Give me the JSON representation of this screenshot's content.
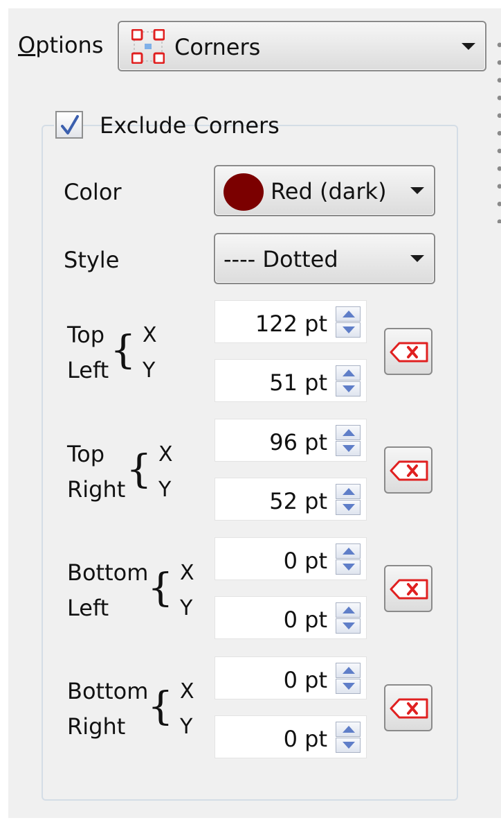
{
  "options": {
    "label_prefix": "",
    "label_ul": "O",
    "label_rest": "ptions",
    "selected": "Corners",
    "icon": "corners-icon"
  },
  "exclude": {
    "label": "Exclude Corners",
    "checked": true
  },
  "color": {
    "label": "Color",
    "selected": "Red (dark)",
    "swatch": "#7b0000"
  },
  "style": {
    "label": "Style",
    "selected": "---- Dotted"
  },
  "axis_labels": {
    "x": "X",
    "y": "Y"
  },
  "corners": [
    {
      "line1": "Top",
      "line2": "Left",
      "x": "122 pt",
      "y": "51 pt"
    },
    {
      "line1": "Top",
      "line2": "Right",
      "x": "96 pt",
      "y": "52 pt"
    },
    {
      "line1": "Bottom",
      "line2": "Left",
      "x": "0 pt",
      "y": "0 pt"
    },
    {
      "line1": "Bottom",
      "line2": "Right",
      "x": "0 pt",
      "y": "0 pt"
    }
  ],
  "colors": {
    "panel_bg": "#f0f0f0",
    "accent_red": "#e02020",
    "spin_arrow": "#5f7ec8"
  }
}
